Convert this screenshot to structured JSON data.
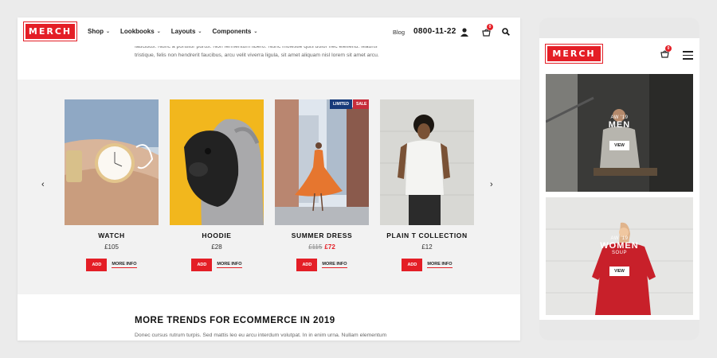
{
  "brand": {
    "logo": "MERCH",
    "accent": "#e41e26"
  },
  "header": {
    "nav": [
      {
        "label": "Shop"
      },
      {
        "label": "Lookbooks"
      },
      {
        "label": "Layouts"
      },
      {
        "label": "Components"
      }
    ],
    "blog": "Blog",
    "phone": "0800-11-22",
    "cart_count": "0",
    "icons": [
      "user-icon",
      "cart-icon",
      "search-icon"
    ]
  },
  "intro": {
    "line1": "faucibus. Nunc a porttitor purus. Non fermentum libero. Nunc molestie quis dolor nec eleifend. Mauris",
    "line2": "tristique, felis non hendrerit faucibus, arcu velit viverra ligula, sit amet aliquam nisl lorem sit amet arcu."
  },
  "products": [
    {
      "name": "WATCH",
      "price": "£105",
      "add": "ADD",
      "more": "MORE INFO"
    },
    {
      "name": "HOODIE",
      "price": "£28",
      "add": "ADD",
      "more": "MORE INFO"
    },
    {
      "name": "SUMMER DRESS",
      "old_price": "£115",
      "price": "£72",
      "add": "ADD",
      "more": "MORE INFO",
      "tags": [
        "LIMITED",
        "SALE"
      ]
    },
    {
      "name": "PLAIN T COLLECTION",
      "price": "£12",
      "add": "ADD",
      "more": "MORE INFO"
    }
  ],
  "carousel": {
    "prev_icon": "chevron-left-icon",
    "next_icon": "chevron-right-icon"
  },
  "trends": {
    "title": "MORE TRENDS FOR ECOMMERCE IN 2019",
    "text": "Donec cursus rutrum turpis. Sed mattis leo eu arcu interdum volutpat. In in enim urna. Nullam elementum"
  },
  "mobile": {
    "logo": "MERCH",
    "cart_count": "0",
    "categories": [
      {
        "sub": "AW '19",
        "title": "MEN",
        "button": "VIEW"
      },
      {
        "sub": "AW '19",
        "title": "WOMEN",
        "sub2": "SOUP",
        "button": "VIEW"
      }
    ]
  }
}
